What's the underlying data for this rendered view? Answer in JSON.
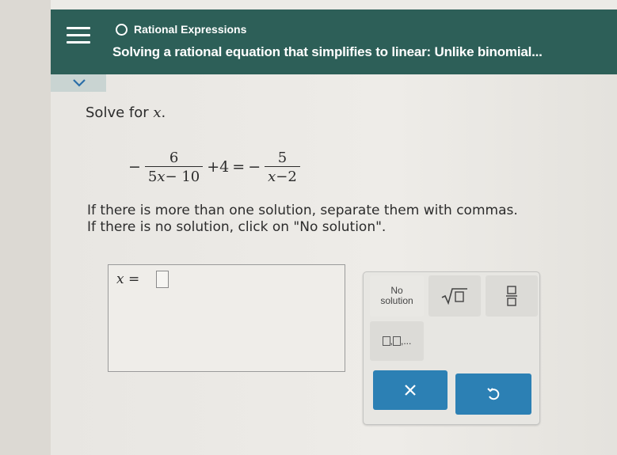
{
  "header": {
    "topic": "Rational Expressions",
    "title": "Solving a rational equation that simplifies to linear: Unlike binomial..."
  },
  "question": {
    "prompt_text": "Solve for ",
    "prompt_var": "x",
    "prompt_end": ".",
    "equation": {
      "lhs_sign": "−",
      "lhs_num": "6",
      "lhs_den_a": "5",
      "lhs_den_var": "x",
      "lhs_den_b": "− 10",
      "plus_term": "+4",
      "equals": "=",
      "rhs_sign": "−",
      "rhs_num": "5",
      "rhs_den_var": "x",
      "rhs_den_b": "−2"
    },
    "instruction_1": "If there is more than one solution, separate them with commas.",
    "instruction_2": "If there is no solution, click on \"No solution\"."
  },
  "answer": {
    "label": "x =",
    "value": ""
  },
  "keypad": {
    "no_solution_line1": "No",
    "no_solution_line2": "solution",
    "sqrt_icon": "sqrt-icon",
    "fraction_icon": "fraction-icon",
    "list_suffix": ",...",
    "clear_icon": "close-icon",
    "undo_icon": "undo-icon",
    "accent_color": "#2c80b4"
  },
  "colors": {
    "header_bg": "#2d5f58"
  }
}
